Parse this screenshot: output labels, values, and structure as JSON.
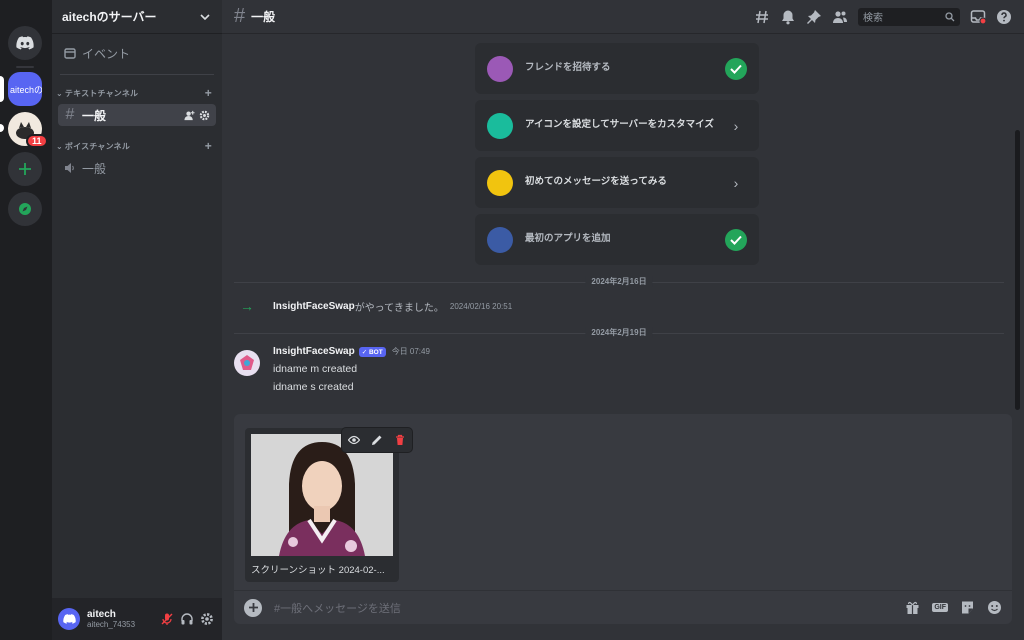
{
  "server_rail": {
    "main_server_label": "aitechのサーバー",
    "notification_count": "11"
  },
  "sidebar": {
    "guild_name": "aitechのサーバー",
    "events_label": "イベント",
    "text_category": "テキストチャンネル",
    "voice_category": "ボイスチャンネル",
    "text_channels": [
      {
        "name": "一般"
      }
    ],
    "voice_channels": [
      {
        "name": "一般"
      }
    ]
  },
  "user_panel": {
    "name": "aitech",
    "sub": "aitech_74353"
  },
  "topbar": {
    "hash": "#",
    "channel_name": "一般",
    "search_placeholder": "検索"
  },
  "onboarding": [
    {
      "label": "フレンドを招待する",
      "status": "done",
      "icon": "invite-icon",
      "color": "#9b59b6"
    },
    {
      "label": "アイコンを設定してサーバーをカスタマイズ",
      "status": "todo",
      "icon": "customize-icon",
      "color": "#1abc9c"
    },
    {
      "label": "初めてのメッセージを送ってみる",
      "status": "todo",
      "icon": "message-icon",
      "color": "#f1c40f"
    },
    {
      "label": "最初のアプリを追加",
      "status": "done",
      "icon": "app-icon",
      "color": "#3b5ba5"
    }
  ],
  "dividers": {
    "first": "2024年2月16日",
    "second": "2024年2月19日"
  },
  "join": {
    "name": "InsightFaceSwap",
    "text": "がやってきました。",
    "timestamp": "2024/02/16 20:51"
  },
  "message": {
    "author": "InsightFaceSwap",
    "bot_tag": "BOT",
    "time": "今日 07:49",
    "lines": [
      "idname m created",
      "idname s created"
    ]
  },
  "composer": {
    "attachment_name": "スクリーンショット 2024-02-...",
    "placeholder": "#一般へメッセージを送信"
  },
  "colors": {
    "accent": "#5865f2",
    "success": "#23a55a",
    "danger": "#f23f43"
  }
}
